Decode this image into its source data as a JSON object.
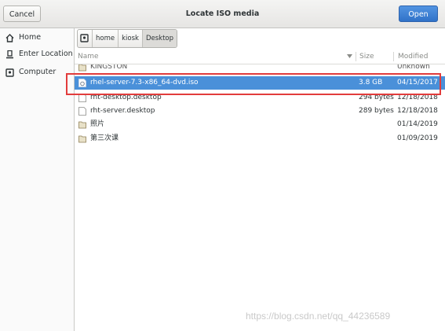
{
  "header": {
    "cancel_label": "Cancel",
    "title": "Locate ISO media",
    "open_label": "Open"
  },
  "sidebar": {
    "items": [
      {
        "label": "Home",
        "icon": "home-icon"
      },
      {
        "label": "Enter Location",
        "icon": "pencil-icon"
      },
      {
        "label": "Computer",
        "icon": "drive-icon"
      }
    ]
  },
  "pathbar": {
    "crumbs": [
      "home",
      "kiosk",
      "Desktop"
    ]
  },
  "list": {
    "columns": {
      "name": "Name",
      "size": "Size",
      "modified": "Modified"
    },
    "rows": [
      {
        "name": "KINGSTON",
        "size": "",
        "modified": "Unknown",
        "type": "folder"
      },
      {
        "name": "rhel-server-7.3-x86_64-dvd.iso",
        "size": "3.8 GB",
        "modified": "04/15/2017",
        "type": "iso",
        "selected": true
      },
      {
        "name": "rht-desktop.desktop",
        "size": "294 bytes",
        "modified": "12/18/2018",
        "type": "file"
      },
      {
        "name": "rht-server.desktop",
        "size": "289 bytes",
        "modified": "12/18/2018",
        "type": "file"
      },
      {
        "name": "照片",
        "size": "",
        "modified": "01/14/2019",
        "type": "folder"
      },
      {
        "name": "第三次课",
        "size": "",
        "modified": "01/09/2019",
        "type": "folder"
      }
    ]
  },
  "watermark": "https://blog.csdn.net/qq_44236589",
  "colors": {
    "selection": "#4a90d9",
    "open_button": "#4a8fdb",
    "annotation_box": "#e23c3c"
  }
}
